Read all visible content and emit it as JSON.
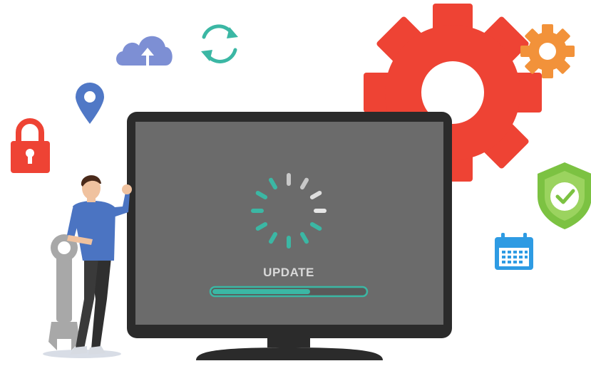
{
  "screen": {
    "status_label": "UPDATE",
    "progress": 0.64
  },
  "colors": {
    "accent_teal": "#3bb7a4",
    "gear_red": "#ee4334",
    "gear_orange": "#f2923a",
    "lock_red": "#ee4334",
    "pin_blue": "#5078c6",
    "cloud_purple": "#7d8fd4",
    "shield_green": "#7cc242",
    "calendar_blue": "#2e9be3",
    "monitor_frame": "#2b2b2b",
    "monitor_screen": "#6b6b6b"
  },
  "icons": [
    "cloud-upload-icon",
    "sync-icon",
    "location-pin-icon",
    "padlock-icon",
    "large-gear-icon",
    "small-gear-icon",
    "security-shield-icon",
    "calendar-icon",
    "wrench-icon"
  ]
}
